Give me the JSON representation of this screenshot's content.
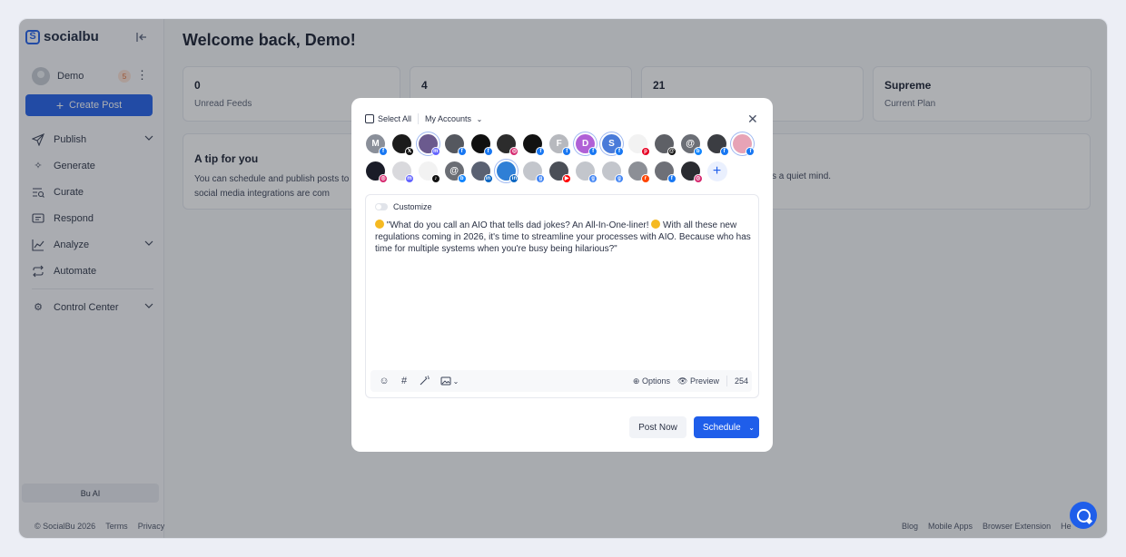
{
  "app": {
    "brand": "socialbu",
    "brand_letter": "S",
    "accent_color": "#1f5eea"
  },
  "sidebar": {
    "user_name": "Demo",
    "notification_count": "5",
    "create_post_label": "Create Post",
    "items": [
      {
        "label": "Publish",
        "icon": "send-icon",
        "has_submenu": true
      },
      {
        "label": "Generate",
        "icon": "sparkle-icon",
        "has_submenu": false
      },
      {
        "label": "Curate",
        "icon": "curate-icon",
        "has_submenu": false
      },
      {
        "label": "Respond",
        "icon": "message-icon",
        "has_submenu": false
      },
      {
        "label": "Analyze",
        "icon": "chart-icon",
        "has_submenu": true
      },
      {
        "label": "Automate",
        "icon": "repeat-icon",
        "has_submenu": false
      },
      {
        "label": "Control Center",
        "icon": "gear-icon",
        "has_submenu": true
      }
    ],
    "bu_ai_label": "Bu AI"
  },
  "main": {
    "welcome": "Welcome back, Demo!",
    "stats": [
      {
        "value": "0",
        "label": "Unread Feeds"
      },
      {
        "value": "4",
        "label": ""
      },
      {
        "value": "21",
        "label": ""
      },
      {
        "value": "Supreme",
        "label": "Current Plan"
      }
    ],
    "tip": {
      "title": "A tip for you",
      "text_left": "You can schedule and publish posts to and social media integrations are com",
      "text_right": "s a quiet mind."
    }
  },
  "footer": {
    "copyright": "© SocialBu 2026",
    "left_links": [
      "Terms",
      "Privacy"
    ],
    "right_links": [
      "Blog",
      "Mobile Apps",
      "Browser Extension",
      "He"
    ]
  },
  "composer": {
    "select_all_label": "Select All",
    "accounts_filter": "My Accounts",
    "customize_label": "Customize",
    "post_text": "\"What do you call an AIO that tells dad jokes? An All-In-One-liner! With all these new regulations coming in 2026, it's time to streamline your processes with AIO. Because who has time for multiple systems when you're busy being hilarious?\"",
    "post_text_part1": "\"What do you call an AIO that tells dad jokes? An All-In-One-liner! ",
    "post_text_part2": " With all these new regulations coming in 2026, it's time to streamline your processes with AIO. Because who has time for multiple systems when you're busy being hilarious?\"",
    "options_label": "Options",
    "preview_label": "Preview",
    "char_count": "254",
    "post_now_label": "Post Now",
    "schedule_label": "Schedule",
    "account_rows": [
      [
        {
          "initial": "M",
          "bg": "#8a8f99",
          "net": "f",
          "net_color": "#1877f2"
        },
        {
          "initial": "",
          "bg": "#1b1b1b",
          "net": "x",
          "net_color": "#111111"
        },
        {
          "initial": "",
          "bg": "#6b5a8e",
          "net": "m",
          "net_color": "#6364ff",
          "ring": true
        },
        {
          "initial": "",
          "bg": "#55585f",
          "net": "f",
          "net_color": "#1877f2"
        },
        {
          "initial": "",
          "bg": "#101010",
          "net": "f",
          "net_color": "#1877f2"
        },
        {
          "initial": "",
          "bg": "#2c2c2c",
          "net": "ig",
          "net_color": "#d6296f"
        },
        {
          "initial": "",
          "bg": "#121212",
          "net": "f",
          "net_color": "#1877f2"
        },
        {
          "initial": "F",
          "bg": "#b7b9be",
          "net": "f",
          "net_color": "#1877f2"
        },
        {
          "initial": "D",
          "bg": "#b061d6",
          "net": "f",
          "net_color": "#1877f2",
          "ring": true
        },
        {
          "initial": "S",
          "bg": "#4a7bd9",
          "net": "f",
          "net_color": "#1877f2",
          "ring": true
        },
        {
          "initial": "",
          "bg": "#f2f2f2",
          "net": "p",
          "net_color": "#e60023"
        },
        {
          "initial": "",
          "bg": "#5e6066",
          "net": "th",
          "net_color": "#111111"
        },
        {
          "initial": "@",
          "bg": "#6b6e75",
          "net": "b",
          "net_color": "#1185fe"
        },
        {
          "initial": "",
          "bg": "#3b3d42",
          "net": "f",
          "net_color": "#1877f2"
        },
        {
          "initial": "",
          "bg": "#e7a3b6",
          "net": "f",
          "net_color": "#1877f2",
          "ring": true
        }
      ],
      [
        {
          "initial": "",
          "bg": "#1a1c28",
          "net": "ig",
          "net_color": "#d6296f"
        },
        {
          "initial": "",
          "bg": "#d9d9dd",
          "net": "m",
          "net_color": "#6364ff"
        },
        {
          "initial": "",
          "bg": "#f2f2f2",
          "net": "tt",
          "net_color": "#111111"
        },
        {
          "initial": "@",
          "bg": "#6b6e75",
          "net": "b",
          "net_color": "#1185fe"
        },
        {
          "initial": "",
          "bg": "#5a6172",
          "net": "in",
          "net_color": "#0a66c2"
        },
        {
          "initial": "",
          "bg": "#2f7fd6",
          "net": "in",
          "net_color": "#0a66c2",
          "ring": true
        },
        {
          "initial": "",
          "bg": "#c3c6cc",
          "net": "g",
          "net_color": "#4285f4"
        },
        {
          "initial": "",
          "bg": "#4b4f57",
          "net": "yt",
          "net_color": "#ff0000"
        },
        {
          "initial": "",
          "bg": "#c3c6cc",
          "net": "g",
          "net_color": "#4285f4"
        },
        {
          "initial": "",
          "bg": "#c3c6cc",
          "net": "g",
          "net_color": "#4285f4"
        },
        {
          "initial": "",
          "bg": "#8c8f96",
          "net": "r",
          "net_color": "#ff4500"
        },
        {
          "initial": "",
          "bg": "#6e7077",
          "net": "f",
          "net_color": "#1877f2"
        },
        {
          "initial": "",
          "bg": "#2a2c31",
          "net": "ig",
          "net_color": "#d6296f"
        }
      ]
    ]
  }
}
